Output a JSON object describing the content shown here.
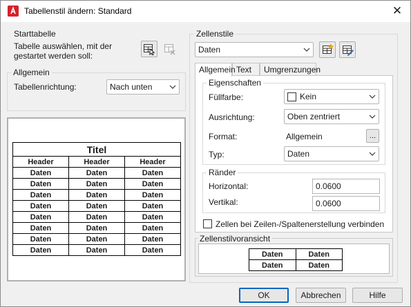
{
  "window": {
    "title": "Tabellenstil ändern: Standard",
    "close_glyph": "✕"
  },
  "start_table": {
    "group_label": "Starttabelle",
    "prompt_line1": "Tabelle auswählen, mit der",
    "prompt_line2": "gestartet werden soll:"
  },
  "general_left": {
    "group_label": "Allgemein",
    "direction_label": "Tabellenrichtung:",
    "direction_value": "Nach unten"
  },
  "table_preview": {
    "title": "Titel",
    "headers": [
      "Header",
      "Header",
      "Header"
    ],
    "rows": [
      [
        "Daten",
        "Daten",
        "Daten"
      ],
      [
        "Daten",
        "Daten",
        "Daten"
      ],
      [
        "Daten",
        "Daten",
        "Daten"
      ],
      [
        "Daten",
        "Daten",
        "Daten"
      ],
      [
        "Daten",
        "Daten",
        "Daten"
      ],
      [
        "Daten",
        "Daten",
        "Daten"
      ],
      [
        "Daten",
        "Daten",
        "Daten"
      ],
      [
        "Daten",
        "Daten",
        "Daten"
      ]
    ]
  },
  "cell_styles": {
    "group_label": "Zellenstile",
    "selected": "Daten"
  },
  "tabs": [
    {
      "label": "Allgemein",
      "active": true
    },
    {
      "label": "Text",
      "active": false
    },
    {
      "label": "Umgrenzungen",
      "active": false
    }
  ],
  "properties": {
    "group_label": "Eigenschaften",
    "fill_label": "Füllfarbe:",
    "fill_value": "Kein",
    "align_label": "Ausrichtung:",
    "align_value": "Oben zentriert",
    "format_label": "Format:",
    "format_value": "Allgemein",
    "format_button": "...",
    "type_label": "Typ:",
    "type_value": "Daten"
  },
  "margins": {
    "group_label": "Ränder",
    "horizontal_label": "Horizontal:",
    "horizontal_value": "0.0600",
    "vertical_label": "Vertikal:",
    "vertical_value": "0.0600"
  },
  "merge_option": {
    "label": "Zellen bei Zeilen-/Spaltenerstellung verbinden",
    "checked": false
  },
  "cell_preview": {
    "group_label": "Zellenstilvoransicht",
    "rows": [
      [
        "Daten",
        "Daten"
      ],
      [
        "Daten",
        "Daten"
      ]
    ]
  },
  "buttons": {
    "ok": "OK",
    "cancel": "Abbrechen",
    "help": "Hilfe"
  },
  "colors": {
    "accent": "#0067c0",
    "app_icon": "#d6212a"
  }
}
